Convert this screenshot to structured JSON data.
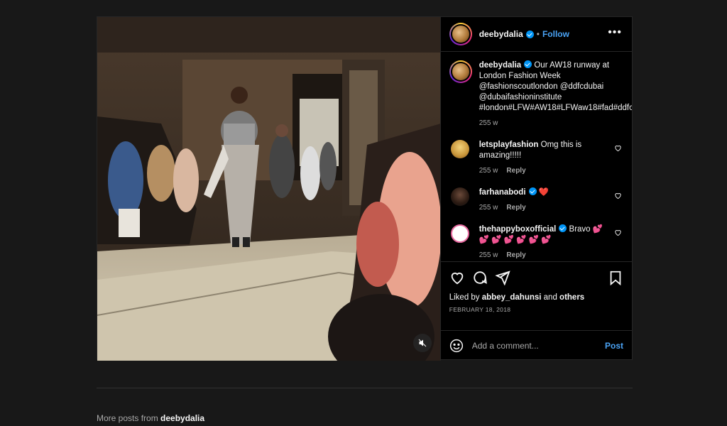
{
  "post": {
    "username": "deebydalia",
    "follow_label": "Follow",
    "more_label": "•••",
    "caption": {
      "username": "deebydalia",
      "text": " Our AW18 runway at London Fashion Week @fashionscoutlondon @ddfcdubai @dubaifashioninstitute #london#LFW#AW18#LFWaw18#fad#ddfc",
      "time": "255 w"
    },
    "comments": [
      {
        "username": "letsplayfashion",
        "text": " Omg this is amazing!!!!!",
        "time": "255 w",
        "reply": "Reply",
        "verified": false
      },
      {
        "username": "farhanabodi",
        "text": " ❤️",
        "time": "255 w",
        "reply": "Reply",
        "verified": true
      },
      {
        "username": "thehappyboxofficial",
        "text": " Bravo 💕 💕 💕 💕 💕 💕 💕",
        "time": "255 w",
        "reply": "Reply",
        "verified": true
      }
    ],
    "likes": {
      "prefix": "Liked by ",
      "user": "abbey_dahunsi",
      "middle": " and ",
      "others": "others"
    },
    "date": "FEBRUARY 18, 2018",
    "add_comment_placeholder": "Add a comment...",
    "post_label": "Post"
  },
  "footer": {
    "more_posts_prefix": "More posts from ",
    "more_posts_user": "deebydalia"
  },
  "colors": {
    "accent": "#0095f6",
    "link": "#4aa3f5",
    "background": "#181818",
    "panel": "#000000",
    "heart": "#ed4956"
  },
  "icons": [
    "verified-icon",
    "more-icon",
    "heart-icon",
    "comment-icon",
    "share-icon",
    "bookmark-icon",
    "emoji-icon",
    "mute-icon"
  ]
}
